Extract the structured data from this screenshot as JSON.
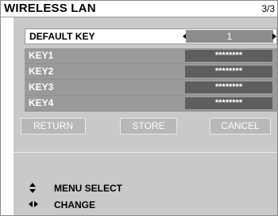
{
  "header": {
    "title": "WIRELESS LAN",
    "page": "3/3"
  },
  "default_key": {
    "label": "DEFAULT KEY",
    "value": "1"
  },
  "keys": [
    {
      "label": "KEY1",
      "value": "********"
    },
    {
      "label": "KEY2",
      "value": "********"
    },
    {
      "label": "KEY3",
      "value": "********"
    },
    {
      "label": "KEY4",
      "value": "********"
    }
  ],
  "buttons": {
    "return": "RETURN",
    "store": "STORE",
    "cancel": "CANCEL"
  },
  "help": {
    "select": "MENU SELECT",
    "change": "CHANGE"
  },
  "colors": {
    "panel": "#c9c9c9",
    "key_row": "#9a9a9a",
    "value_box": "#5e5e5e"
  }
}
